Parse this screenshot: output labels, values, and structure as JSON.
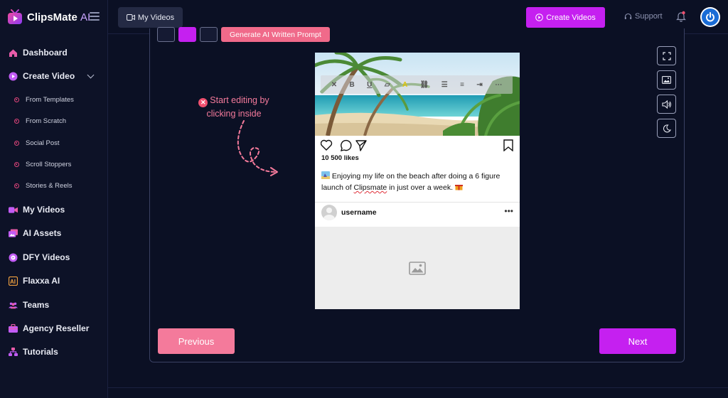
{
  "app": {
    "name": "ClipsMate",
    "name_suffix": "AI"
  },
  "sidebar": {
    "items": [
      {
        "label": "Dashboard"
      },
      {
        "label": "Create Video"
      },
      {
        "label": "From Templates"
      },
      {
        "label": "From Scratch"
      },
      {
        "label": "Social Post"
      },
      {
        "label": "Scroll Stoppers"
      },
      {
        "label": "Stories & Reels"
      },
      {
        "label": "My Videos"
      },
      {
        "label": "AI Assets"
      },
      {
        "label": "DFY Videos"
      },
      {
        "label": "Flaxxa AI"
      },
      {
        "label": "Teams"
      },
      {
        "label": "Agency Reseller"
      },
      {
        "label": "Tutorials"
      }
    ]
  },
  "topbar": {
    "my_videos_label": "My Videos",
    "create_videos_label": "Create Videos",
    "support_label": "Support"
  },
  "editor": {
    "generate_prompt_label": "Generate AI Written Prompt",
    "hint_line1": "Start editing by",
    "hint_line2": "clicking inside",
    "previous_label": "Previous",
    "next_label": "Next"
  },
  "post": {
    "likes": "10 500 likes",
    "caption_part1": "Enjoying my life on the beach after doing a 6 figure launch of ",
    "caption_brand": "Clipsmate",
    "caption_part2": " in just over a week.",
    "username": "username",
    "more": "•••"
  },
  "colors": {
    "accent": "#c520f0",
    "pink": "#f47a9b",
    "background": "#0b1024"
  }
}
